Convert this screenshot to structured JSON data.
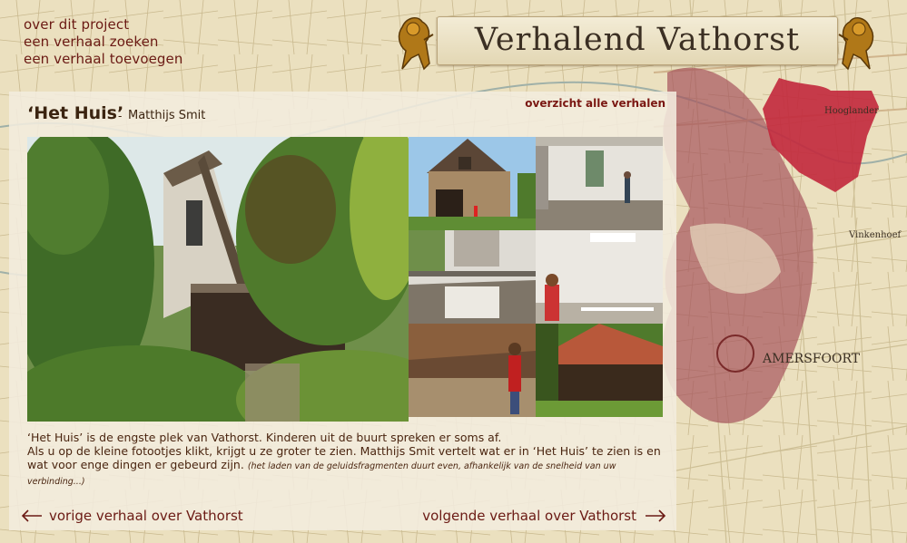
{
  "site": {
    "title": "Verhalend Vathorst"
  },
  "nav": {
    "items": [
      {
        "label": "over dit project"
      },
      {
        "label": "een verhaal zoeken"
      },
      {
        "label": "een verhaal toevoegen"
      }
    ]
  },
  "story": {
    "title": "‘Het Huis’",
    "separator": "-",
    "author": "Matthijs Smit",
    "overview_link": "overzicht alle verhalen",
    "description_line1": "‘Het Huis’ is de engste plek van Vathorst. Kinderen uit de buurt spreken er soms af.",
    "description_line2": "Als u op de kleine fotootjes klikt, krijgt u ze groter te zien. Matthijs Smit vertelt wat er in ‘Het Huis’ te zien is en wat voor enge dingen er gebeurd zijn.",
    "description_note": "(het laden van de geluidsfragmenten duurt even, afhankelijk van de snelheid van uw verbinding...)"
  },
  "pagination": {
    "prev_label": "vorige verhaal over Vathorst",
    "next_label": "volgende verhaal over Vathorst"
  },
  "colors": {
    "link": "#6b1a14",
    "map_region": "#a4505a",
    "map_highlight": "#c2283c"
  },
  "icons": {
    "prev": "arrow-left-icon",
    "next": "arrow-right-icon",
    "crest": "lion-crest-icon"
  }
}
